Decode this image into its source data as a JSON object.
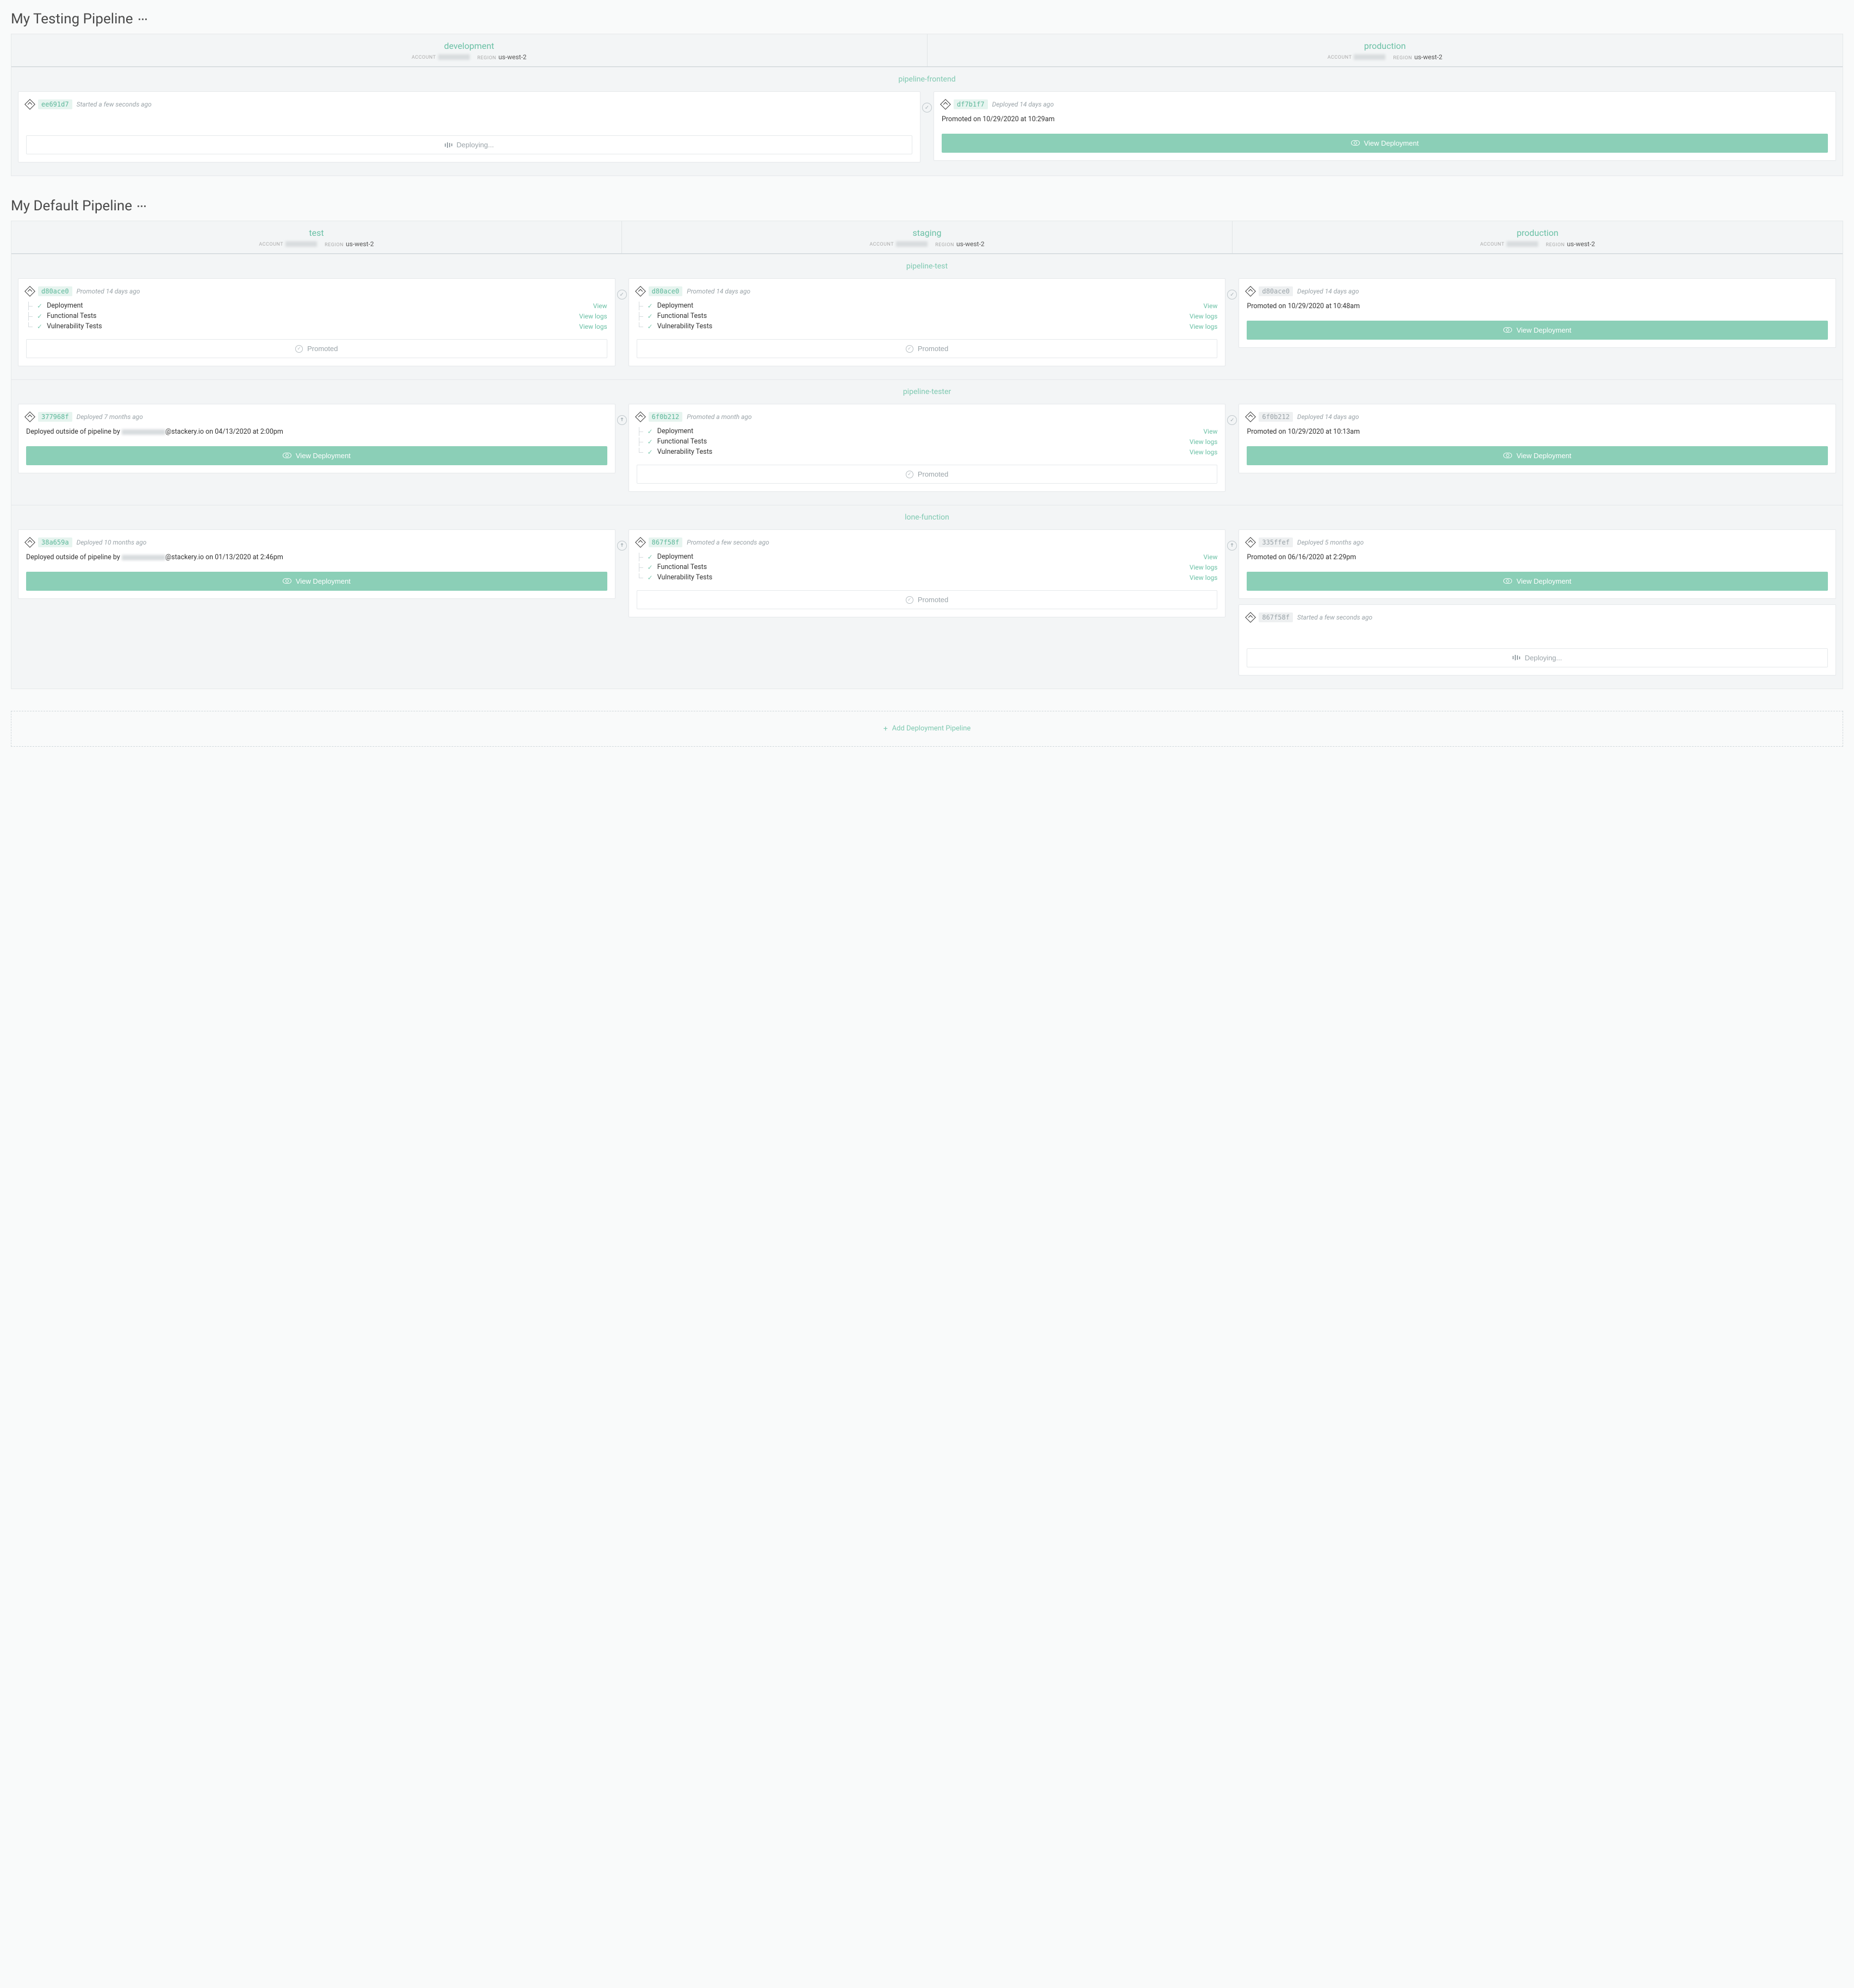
{
  "common": {
    "account_label": "ACCOUNT",
    "region_label": "REGION",
    "region": "us-west-2",
    "deploying": "Deploying...",
    "view_deployment": "View Deployment",
    "promoted": "Promoted",
    "view": "View",
    "view_logs": "View logs",
    "add_pipeline": "Add Deployment Pipeline",
    "steps": {
      "deployment": "Deployment",
      "functional": "Functional Tests",
      "vulnerability": "Vulnerability Tests"
    }
  },
  "pipelines": [
    {
      "title": "My Testing Pipeline",
      "stages": [
        {
          "name": "development"
        },
        {
          "name": "production"
        }
      ],
      "stacks": [
        {
          "name": "pipeline-frontend",
          "cols": [
            {
              "cards": [
                {
                  "sha": "ee691d7",
                  "sha_style": "green",
                  "status": "Started a few seconds ago",
                  "action": "deploying"
                }
              ]
            },
            {
              "conn": "check",
              "cards": [
                {
                  "sha": "df7b1f7",
                  "sha_style": "green",
                  "status": "Deployed 14 days ago",
                  "body": "Promoted on 10/29/2020 at 10:29am",
                  "action": "view"
                }
              ]
            }
          ]
        }
      ]
    },
    {
      "title": "My Default Pipeline",
      "stages": [
        {
          "name": "test"
        },
        {
          "name": "staging"
        },
        {
          "name": "production"
        }
      ],
      "stacks": [
        {
          "name": "pipeline-test",
          "cols": [
            {
              "cards": [
                {
                  "sha": "d80ace0",
                  "sha_style": "green",
                  "status": "Promoted 14 days ago",
                  "steps": [
                    {
                      "name_key": "deployment",
                      "link": "view"
                    },
                    {
                      "name_key": "functional",
                      "link": "view_logs"
                    },
                    {
                      "name_key": "vulnerability",
                      "link": "view_logs"
                    }
                  ],
                  "action": "promoted"
                }
              ]
            },
            {
              "conn": "check",
              "cards": [
                {
                  "sha": "d80ace0",
                  "sha_style": "green",
                  "status": "Promoted 14 days ago",
                  "steps": [
                    {
                      "name_key": "deployment",
                      "link": "view"
                    },
                    {
                      "name_key": "functional",
                      "link": "view_logs"
                    },
                    {
                      "name_key": "vulnerability",
                      "link": "view_logs"
                    }
                  ],
                  "action": "promoted"
                }
              ]
            },
            {
              "conn": "check",
              "cards": [
                {
                  "sha": "d80ace0",
                  "sha_style": "gray",
                  "status": "Deployed 14 days ago",
                  "body": "Promoted on 10/29/2020 at 10:48am",
                  "action": "view"
                }
              ]
            }
          ]
        },
        {
          "name": "pipeline-tester",
          "cols": [
            {
              "cards": [
                {
                  "sha": "377968f",
                  "sha_style": "green",
                  "status": "Deployed 7 months ago",
                  "body_pre": "Deployed outside of pipeline by ",
                  "body_post": "@stackery.io on 04/13/2020 at 2:00pm",
                  "action": "view"
                }
              ]
            },
            {
              "conn": "promote",
              "cards": [
                {
                  "sha": "6f0b212",
                  "sha_style": "green",
                  "status": "Promoted a month ago",
                  "steps": [
                    {
                      "name_key": "deployment",
                      "link": "view"
                    },
                    {
                      "name_key": "functional",
                      "link": "view_logs"
                    },
                    {
                      "name_key": "vulnerability",
                      "link": "view_logs"
                    }
                  ],
                  "action": "promoted"
                }
              ]
            },
            {
              "conn": "check",
              "cards": [
                {
                  "sha": "6f0b212",
                  "sha_style": "gray",
                  "status": "Deployed 14 days ago",
                  "body": "Promoted on 10/29/2020 at 10:13am",
                  "action": "view"
                }
              ]
            }
          ]
        },
        {
          "name": "lone-function",
          "cols": [
            {
              "cards": [
                {
                  "sha": "38a659a",
                  "sha_style": "green",
                  "status": "Deployed 10 months ago",
                  "body_pre": "Deployed outside of pipeline by ",
                  "body_post": "@stackery.io on 01/13/2020 at 2:46pm",
                  "action": "view"
                }
              ]
            },
            {
              "conn": "promote",
              "cards": [
                {
                  "sha": "867f58f",
                  "sha_style": "green",
                  "status": "Promoted a few seconds ago",
                  "steps": [
                    {
                      "name_key": "deployment",
                      "link": "view"
                    },
                    {
                      "name_key": "functional",
                      "link": "view_logs"
                    },
                    {
                      "name_key": "vulnerability",
                      "link": "view_logs"
                    }
                  ],
                  "action": "promoted"
                }
              ]
            },
            {
              "conn": "promote",
              "cards": [
                {
                  "sha": "335ffef",
                  "sha_style": "gray",
                  "status": "Deployed 5 months ago",
                  "body": "Promoted on 06/16/2020 at 2:29pm",
                  "action": "view"
                },
                {
                  "sha": "867f58f",
                  "sha_style": "gray",
                  "status": "Started a few seconds ago",
                  "action": "deploying"
                }
              ]
            }
          ]
        }
      ]
    }
  ]
}
